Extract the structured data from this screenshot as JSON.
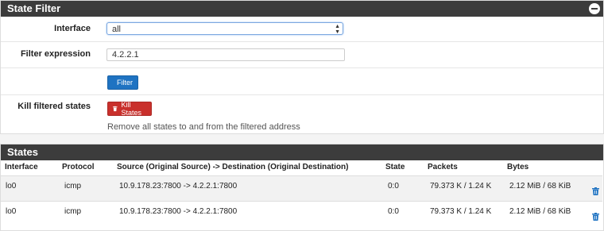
{
  "state_filter": {
    "title": "State Filter",
    "interface_label": "Interface",
    "interface_value": "all",
    "filter_expression_label": "Filter expression",
    "filter_expression_value": "4.2.2.1",
    "filter_button_label": "Filter",
    "kill_label": "Kill filtered states",
    "kill_button_label": "Kill States",
    "kill_help": "Remove all states to and from the filtered address"
  },
  "states": {
    "title": "States",
    "columns": [
      "Interface",
      "Protocol",
      "Source (Original Source) -> Destination (Original Destination)",
      "State",
      "Packets",
      "Bytes"
    ],
    "rows": [
      {
        "interface": "lo0",
        "protocol": "icmp",
        "src_dst": "10.9.178.23:7800 -> 4.2.2.1:7800",
        "state": "0:0",
        "packets": "79.373 K / 1.24 K",
        "bytes": "2.12 MiB / 68 KiB"
      },
      {
        "interface": "lo0",
        "protocol": "icmp",
        "src_dst": "10.9.178.23:7800 -> 4.2.2.1:7800",
        "state": "0:0",
        "packets": "79.373 K / 1.24 K",
        "bytes": "2.12 MiB / 68 KiB"
      }
    ]
  },
  "colors": {
    "header_bg": "#3c3c3c",
    "primary": "#1f73c2",
    "danger": "#c9302c",
    "trash_icon": "#1f73c2"
  },
  "icons": [
    "minus-circle-icon",
    "filter-icon",
    "trash-icon"
  ]
}
